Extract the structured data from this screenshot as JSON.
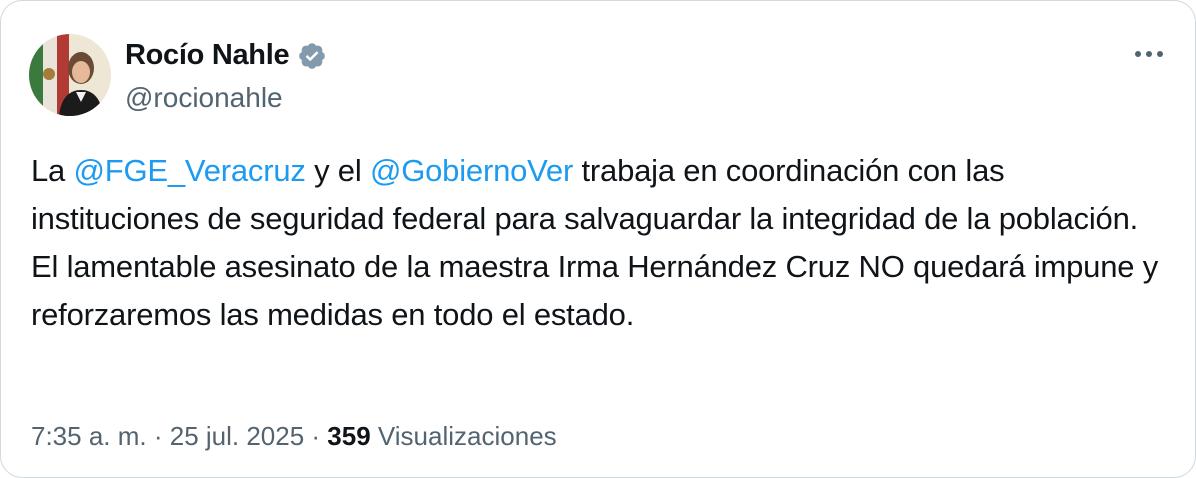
{
  "author": {
    "name": "Rocío Nahle",
    "handle": "@rocionahle",
    "verified_icon": "verified-badge-icon"
  },
  "more_icon": "more-options-icon",
  "tweet": {
    "line1_pre": "La ",
    "mention1": "@FGE_Veracruz",
    "line1_mid": " y el ",
    "mention2": "@GobiernoVer",
    "line1_post": " trabaja en coordinación con las instituciones de seguridad federal para salvaguardar la integridad de la población.",
    "line2": "El lamentable asesinato de la maestra Irma Hernández Cruz NO quedará impune y reforzaremos las medidas en todo el estado."
  },
  "meta": {
    "time": "7:35 a. m.",
    "sep1": " · ",
    "date": "25 jul. 2025",
    "sep2": " · ",
    "views_count": "359",
    "views_label": " Visualizaciones"
  },
  "colors": {
    "accent": "#1d9bf0",
    "text": "#0f1419",
    "muted": "#536471"
  }
}
